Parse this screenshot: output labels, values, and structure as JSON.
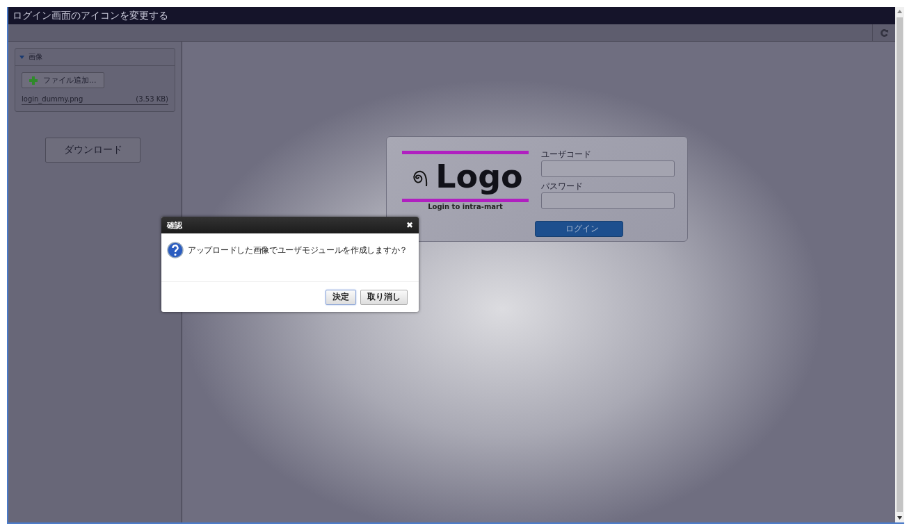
{
  "window": {
    "title": "ログイン画面のアイコンを変更する"
  },
  "sidebar": {
    "section": {
      "title": "画像",
      "expanded": true,
      "add_button": "ファイル追加...",
      "files": [
        {
          "name": "login_dummy.png",
          "size": "(3.53 KB)"
        }
      ]
    },
    "download_button": "ダウンロード"
  },
  "login_preview": {
    "logo": "Logo",
    "caption": "Login to intra-mart",
    "fields": [
      {
        "label": "ユーザコード"
      },
      {
        "label": "パスワード"
      }
    ],
    "button": "ログイン"
  },
  "dialog": {
    "title": "確認",
    "close": "✖",
    "message": "アップロードした画像でユーザモジュールを作成しますか？",
    "buttons": [
      {
        "label": "決定",
        "selected": true
      },
      {
        "label": "取り消し",
        "selected": false
      }
    ]
  }
}
